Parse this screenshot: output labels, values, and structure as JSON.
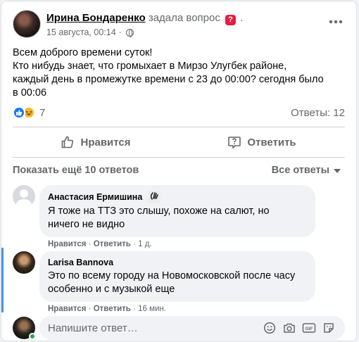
{
  "post": {
    "author": "Ирина Бондаренко",
    "action": "задала вопрос",
    "badge_glyph": "?",
    "trailing_dot": ".",
    "date": "15 августа, 00:14",
    "separator": "·",
    "text_lines": [
      "Всем доброго времени суток!",
      "Кто нибудь знает, что громыхает в Мирзо Улугбек районе,",
      "каждый день в промежутке времени с 23 до 00:00? сегодня было",
      "в 00:06"
    ],
    "reaction_count": "7",
    "answers_label": "Ответы: 12",
    "icons": {
      "more": "more-horizontal-icon",
      "audience": "globe-icon"
    }
  },
  "actions": {
    "like_label": "Нравится",
    "reply_label": "Ответить"
  },
  "thread": {
    "view_more": "Показать ещё 10 ответов",
    "filter_label": "Все ответы"
  },
  "comments": [
    {
      "name": "Анастасия Ермишина",
      "lines": [
        "Я тоже на ТТЗ это слышу, похоже на салют, но",
        "ничего не видно"
      ],
      "like": "Нравится",
      "reply": "Ответить",
      "dot": "·",
      "time": "1 д."
    },
    {
      "name": "Larisa Bannova",
      "lines": [
        "Это по всему городу на Новомосковской после часу",
        "особенно и с музыкой еще"
      ],
      "like": "Нравится",
      "reply": "Ответить",
      "dot": "·",
      "time": "16 мин."
    }
  ],
  "composer": {
    "placeholder": "Напишите ответ…",
    "gif": "GIF"
  },
  "colors": {
    "accent": "#1877f2",
    "muted": "#65676b",
    "bubble": "#f0f2f5",
    "online": "#31a24c"
  }
}
